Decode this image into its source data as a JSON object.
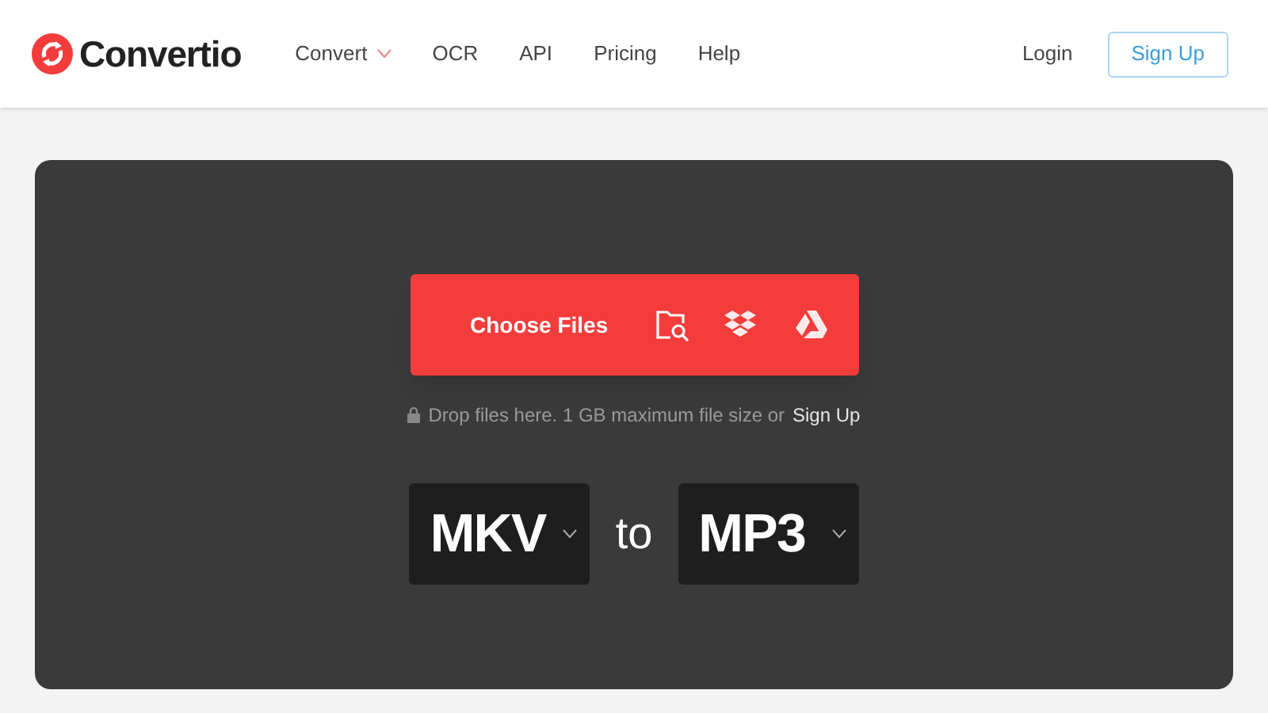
{
  "header": {
    "logo": "Convertio",
    "nav": [
      {
        "label": "Convert",
        "dropdown": true
      },
      {
        "label": "OCR",
        "dropdown": false
      },
      {
        "label": "API",
        "dropdown": false
      },
      {
        "label": "Pricing",
        "dropdown": false
      },
      {
        "label": "Help",
        "dropdown": false
      }
    ],
    "login": "Login",
    "signup": "Sign Up"
  },
  "upload": {
    "button": "Choose Files",
    "note": "Drop files here. 1 GB maximum file size or",
    "note_link": "Sign Up"
  },
  "conversion": {
    "from": "MKV",
    "separator": "to",
    "to": "MP3"
  }
}
